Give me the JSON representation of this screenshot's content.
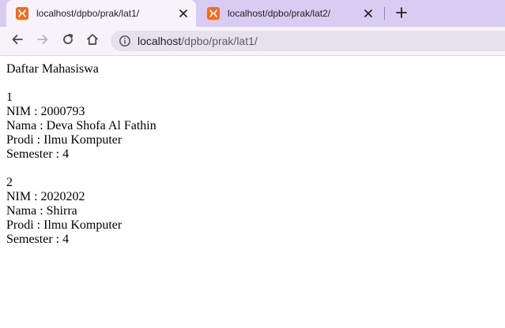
{
  "browser": {
    "tabs": [
      {
        "title": "localhost/dpbo/prak/lat1/",
        "active": true,
        "icon": "xampp-icon"
      },
      {
        "title": "localhost/dpbo/prak/lat2/",
        "active": false,
        "icon": "xampp-icon"
      }
    ],
    "address": {
      "host": "localhost",
      "path": "/dpbo/prak/lat1/"
    },
    "colors": {
      "tabstrip": "#d9ccf2",
      "toolbar": "#f6f3fb",
      "favicon": "#f36a1f"
    }
  },
  "page": {
    "heading": "Daftar Mahasiswa",
    "students": [
      {
        "no": "1",
        "nim": "NIM : 2000793",
        "nama": "Nama : Deva Shofa Al Fathin",
        "prodi": "Prodi : Ilmu Komputer",
        "semester": "Semester : 4"
      },
      {
        "no": "2",
        "nim": "NIM : 2020202",
        "nama": "Nama : Shirra",
        "prodi": "Prodi : Ilmu Komputer",
        "semester": "Semester : 4"
      }
    ]
  }
}
